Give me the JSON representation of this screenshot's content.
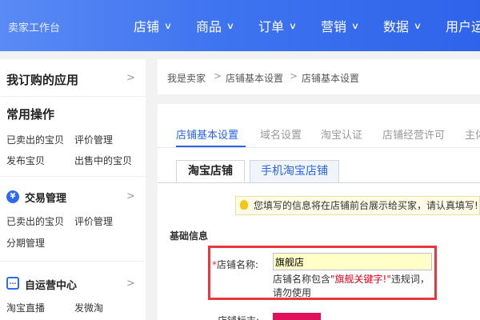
{
  "topnav": {
    "brand": "卖家工作台",
    "items": [
      "店铺",
      "商品",
      "订单",
      "营销",
      "数据",
      "用户运"
    ]
  },
  "sidebar": {
    "purchased_apps": "我订购的应用",
    "common_ops": {
      "title": "常用操作",
      "links": [
        "已卖出的宝贝",
        "评价管理",
        "发布宝贝",
        "出售中的宝贝"
      ]
    },
    "trade": {
      "title": "交易管理",
      "links": [
        "已卖出的宝贝",
        "评价管理",
        "分期管理"
      ]
    },
    "self_ops": {
      "title": "自运营中心",
      "links": [
        "淘宝直播",
        "发微淘"
      ]
    }
  },
  "breadcrumb": [
    "我是卖家",
    "店铺基本设置",
    "店铺基本设置"
  ],
  "tabs": [
    "店铺基本设置",
    "域名设置",
    "淘宝认证",
    "店铺经营许可",
    "主体"
  ],
  "subtabs": [
    "淘宝店铺",
    "手机淘宝店铺"
  ],
  "notice": "您填写的信息将在店铺前台展示给买家，请认真填写!",
  "section_title": "基础信息",
  "shop_name_field": {
    "required_mark": "*",
    "label": "店铺名称:",
    "value": "旗舰店",
    "warning_prefix": "店铺名称包含",
    "warning_keyword": "\"旗舰关键字!\"",
    "warning_suffix": "违规词，请勿使用"
  },
  "shop_logo_field": {
    "label": "店铺标志:"
  }
}
